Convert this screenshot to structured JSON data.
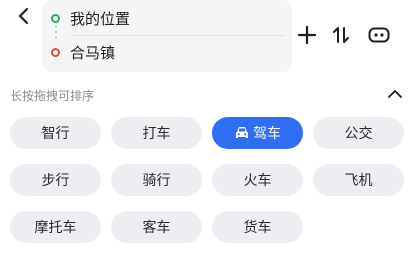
{
  "route": {
    "start": "我的位置",
    "end": "合马镇"
  },
  "hint": "长按拖拽可排序",
  "modes": [
    {
      "label": "智行",
      "selected": false,
      "icon": ""
    },
    {
      "label": "打车",
      "selected": false,
      "icon": ""
    },
    {
      "label": "驾车",
      "selected": true,
      "icon": "car-icon"
    },
    {
      "label": "公交",
      "selected": false,
      "icon": ""
    },
    {
      "label": "步行",
      "selected": false,
      "icon": ""
    },
    {
      "label": "骑行",
      "selected": false,
      "icon": ""
    },
    {
      "label": "火车",
      "selected": false,
      "icon": ""
    },
    {
      "label": "飞机",
      "selected": false,
      "icon": ""
    },
    {
      "label": "摩托车",
      "selected": false,
      "icon": ""
    },
    {
      "label": "客车",
      "selected": false,
      "icon": ""
    },
    {
      "label": "货车",
      "selected": false,
      "icon": ""
    }
  ],
  "colors": {
    "accent": "#2f6df4",
    "start_dot": "#20b262",
    "end_dot": "#e8453a",
    "chip_bg": "#eceef1"
  },
  "icons": {
    "back": "chevron-left-icon",
    "add": "plus-icon",
    "swap": "swap-vertical-icon",
    "more": "more-options-icon",
    "collapse": "chevron-up-icon"
  }
}
